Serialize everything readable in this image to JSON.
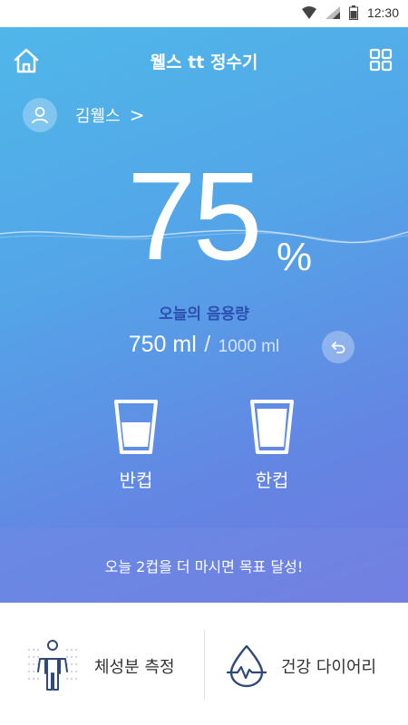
{
  "statusbar": {
    "time": "12:30"
  },
  "header": {
    "title": "웰스 tt 정수기"
  },
  "user": {
    "name": "김웰스",
    "chevron": ">"
  },
  "progress": {
    "percent": "75",
    "percent_sign": "%",
    "fraction": 0.75
  },
  "intake": {
    "label": "오늘의 음용량",
    "current": "750 ml",
    "separator": "/",
    "goal": "1000 ml"
  },
  "cups": [
    {
      "label": "반컵",
      "icon": "half-cup-icon"
    },
    {
      "label": "한컵",
      "icon": "full-cup-icon"
    }
  ],
  "goal_message": "오늘 2컵을 더 마시면 목표 달성!",
  "bottom_nav": [
    {
      "label": "체성분 측정",
      "icon": "body-composition-icon"
    },
    {
      "label": "건강 다이어리",
      "icon": "water-drop-heartbeat-icon"
    }
  ],
  "colors": {
    "accent": "#2c4fb0",
    "gradient_top": "#4fb9e9",
    "gradient_bottom": "#6f79e0"
  }
}
